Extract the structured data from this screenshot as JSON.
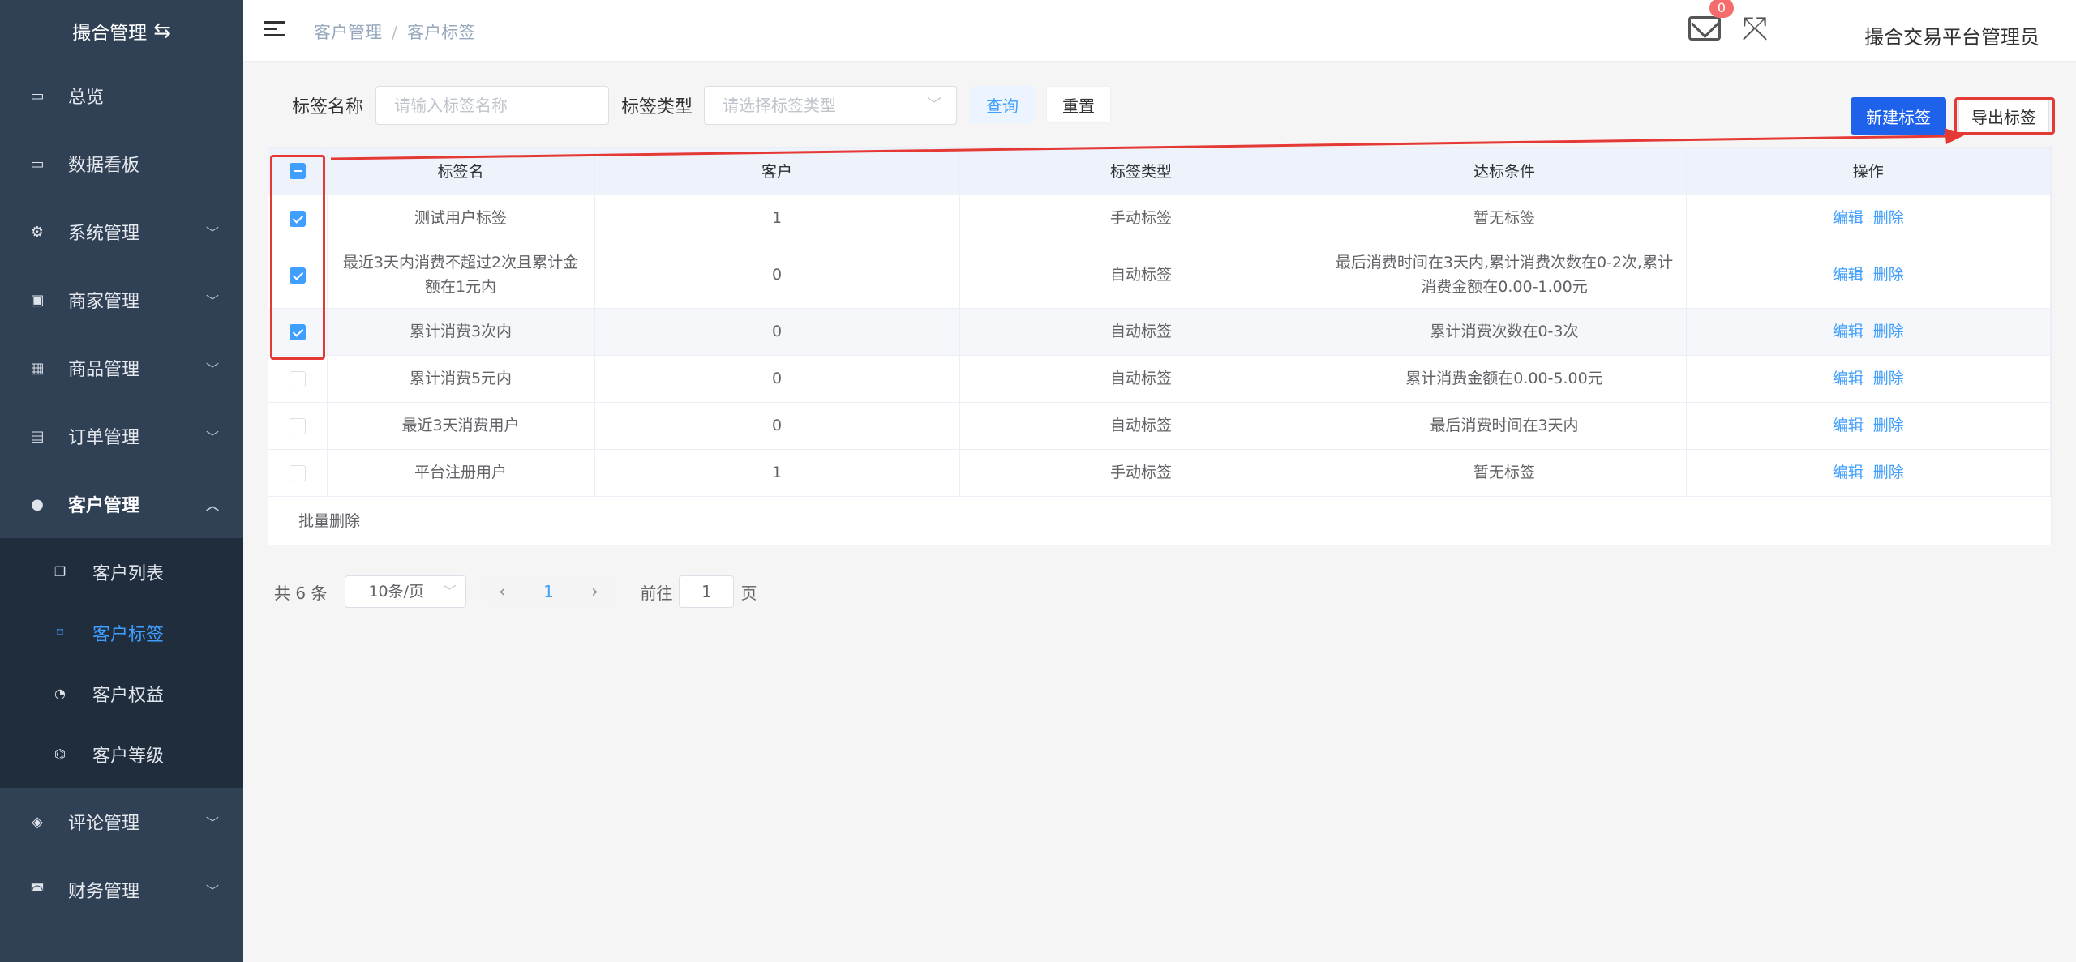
{
  "sidebar": {
    "logo": "撮合管理",
    "menu": [
      {
        "label": "总览",
        "icon": "monitor-icon"
      },
      {
        "label": "数据看板",
        "icon": "monitor-icon"
      },
      {
        "label": "系统管理",
        "icon": "gear-icon"
      },
      {
        "label": "商家管理",
        "icon": "store-icon"
      },
      {
        "label": "商品管理",
        "icon": "gift-icon"
      },
      {
        "label": "订单管理",
        "icon": "document-icon"
      },
      {
        "label": "客户管理",
        "icon": "user-icon"
      }
    ],
    "submenu": [
      {
        "label": "客户列表",
        "icon": "copy-icon"
      },
      {
        "label": "客户标签",
        "icon": "bookmark-icon"
      },
      {
        "label": "客户权益",
        "icon": "medal-icon"
      },
      {
        "label": "客户等级",
        "icon": "puzzle-icon"
      }
    ],
    "menu_after": [
      {
        "label": "评论管理",
        "icon": "comment-icon"
      },
      {
        "label": "财务管理",
        "icon": "finance-icon"
      }
    ]
  },
  "header": {
    "breadcrumb": [
      "客户管理",
      "客户标签"
    ],
    "badge_count": "0",
    "admin_name": "撮合交易平台管理员"
  },
  "filter": {
    "name_label": "标签名称",
    "name_placeholder": "请输入标签名称",
    "type_label": "标签类型",
    "type_placeholder": "请选择标签类型",
    "query_label": "查询",
    "reset_label": "重置",
    "new_label": "新建标签",
    "export_label": "导出标签"
  },
  "table": {
    "columns": [
      "标签名",
      "客户",
      "标签类型",
      "达标条件",
      "操作"
    ],
    "rows": [
      {
        "name": "测试用户标签",
        "customers": "1",
        "type": "手动标签",
        "condition": "暂无标签",
        "checked": true
      },
      {
        "name": "最近3天内消费不超过2次且累计金额在1元内",
        "customers": "0",
        "type": "自动标签",
        "condition": "最后消费时间在3天内,累计消费次数在0-2次,累计消费金额在0.00-1.00元",
        "checked": true
      },
      {
        "name": "累计消费3次内",
        "customers": "0",
        "type": "自动标签",
        "condition": "累计消费次数在0-3次",
        "checked": true
      },
      {
        "name": "累计消费5元内",
        "customers": "0",
        "type": "自动标签",
        "condition": "累计消费金额在0.00-5.00元",
        "checked": false
      },
      {
        "name": "最近3天消费用户",
        "customers": "0",
        "type": "自动标签",
        "condition": "最后消费时间在3天内",
        "checked": false
      },
      {
        "name": "平台注册用户",
        "customers": "1",
        "type": "手动标签",
        "condition": "暂无标签",
        "checked": false
      }
    ],
    "edit_label": "编辑",
    "delete_label": "删除",
    "batch_delete": "批量删除"
  },
  "pagination": {
    "total": "共 6 条",
    "page_size": "10条/页",
    "current_page": "1",
    "jump_prefix": "前往",
    "jump_value": "1",
    "jump_suffix": "页"
  },
  "colors": {
    "sidebar_bg": "#304156",
    "active": "#409eff",
    "primary_button": "#1e62ec",
    "annotation": "#e53935"
  }
}
